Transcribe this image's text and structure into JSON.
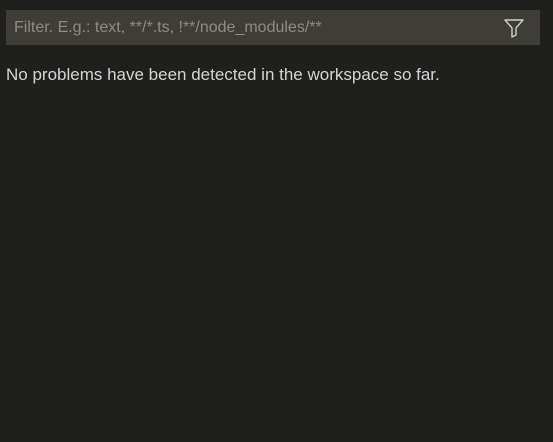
{
  "problems_panel": {
    "filter": {
      "placeholder": "Filter. E.g.: text, **/*.ts, !**/node_modules/**",
      "value": "",
      "filter_icon": "filter-funnel-icon"
    },
    "empty_message": "No problems have been detected in the workspace so far."
  },
  "colors": {
    "background": "#1f1f1d",
    "filter_background": "#3f3e36",
    "text": "#d4d4d4",
    "placeholder": "#8c8c86"
  }
}
